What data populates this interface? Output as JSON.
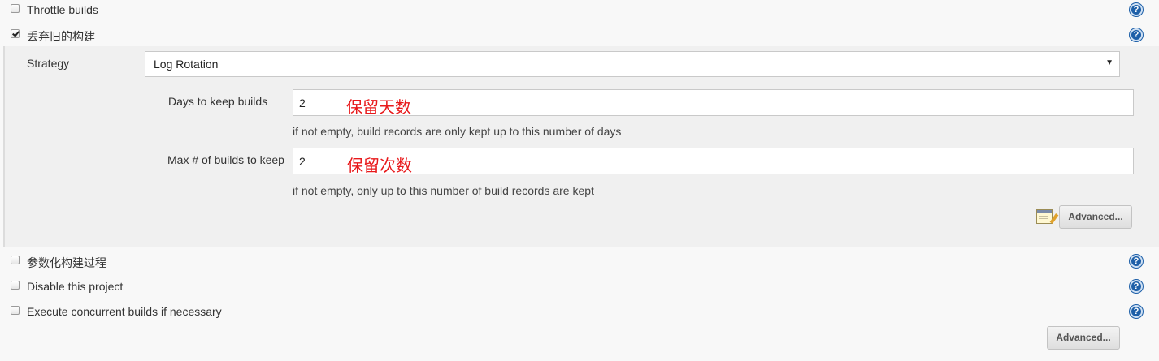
{
  "options": {
    "throttle_builds": {
      "label": "Throttle builds",
      "checked": false
    },
    "discard_old_builds": {
      "label": "丢弃旧的构建",
      "checked": true
    },
    "parameterized": {
      "label": "参数化构建过程",
      "checked": false
    },
    "disable_project": {
      "label": "Disable this project",
      "checked": false
    },
    "concurrent_builds": {
      "label": "Execute concurrent builds if necessary",
      "checked": false
    }
  },
  "discard_panel": {
    "strategy_label": "Strategy",
    "strategy_value": "Log Rotation",
    "strategy_arrow": "▼",
    "days_label": "Days to keep builds",
    "days_value": "2",
    "days_annotation": "保留天数",
    "days_hint": "if not empty, build records are only kept up to this number of days",
    "max_label": "Max # of builds to keep",
    "max_value": "2",
    "max_annotation": "保留次数",
    "max_hint": "if not empty, only up to this number of build records are kept",
    "advanced_label": "Advanced..."
  },
  "footer": {
    "advanced_label": "Advanced..."
  },
  "icons": {
    "help": "help-icon",
    "notepad": "notepad-icon"
  },
  "colors": {
    "annotation": "#e8191b",
    "help": "#1d5fa8"
  },
  "help_glyph": "?"
}
